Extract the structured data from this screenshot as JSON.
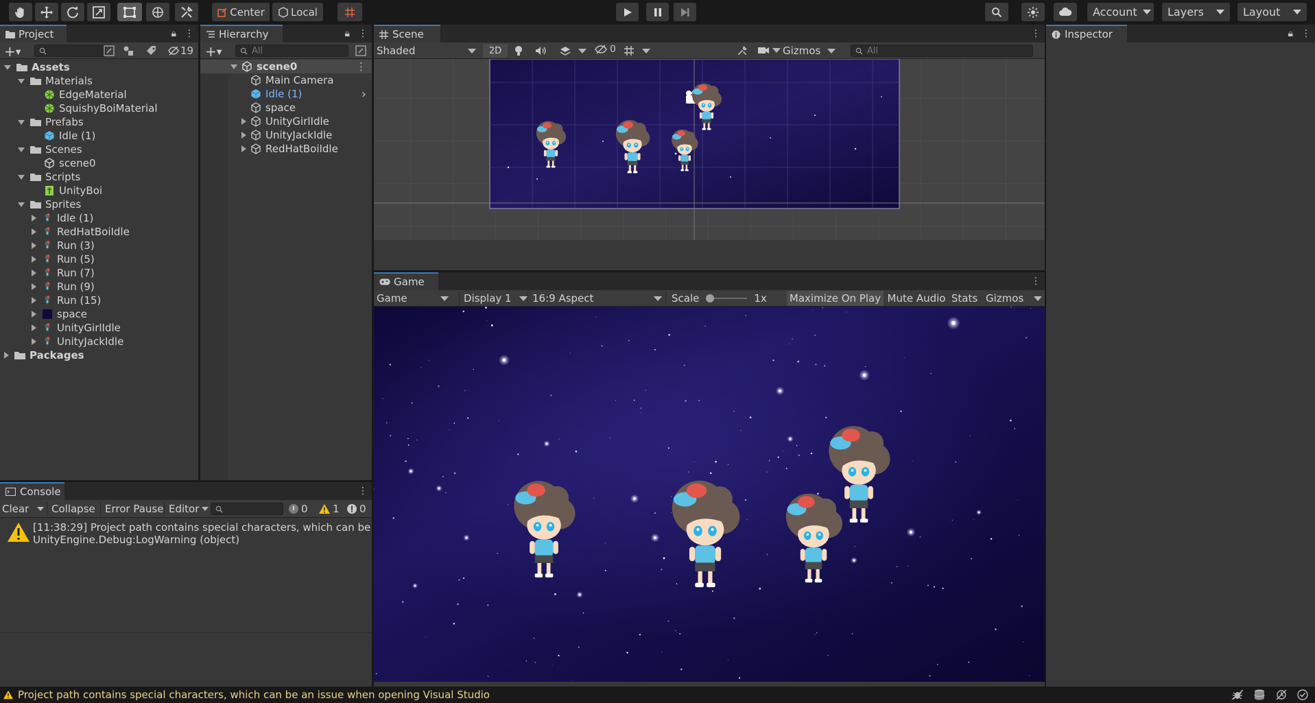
{
  "toolbar": {
    "pivot_label": "Center",
    "space_label": "Local",
    "account_label": "Account",
    "layers_label": "Layers",
    "layout_label": "Layout"
  },
  "project": {
    "tab": "Project",
    "hidden_count": "19",
    "tree": [
      {
        "label": "Assets",
        "indent": 0,
        "expand": "open",
        "icon": "folder-icon",
        "bold": true
      },
      {
        "label": "Materials",
        "indent": 1,
        "expand": "open",
        "icon": "folder-icon"
      },
      {
        "label": "EdgeMaterial",
        "indent": 2,
        "expand": "none",
        "icon": "material-icon"
      },
      {
        "label": "SquishyBoiMaterial",
        "indent": 2,
        "expand": "none",
        "icon": "material-icon"
      },
      {
        "label": "Prefabs",
        "indent": 1,
        "expand": "open",
        "icon": "folder-icon"
      },
      {
        "label": "Idle (1)",
        "indent": 2,
        "expand": "none",
        "icon": "prefab-icon"
      },
      {
        "label": "Scenes",
        "indent": 1,
        "expand": "open",
        "icon": "folder-icon"
      },
      {
        "label": "scene0",
        "indent": 2,
        "expand": "none",
        "icon": "unity-scene-icon"
      },
      {
        "label": "Scripts",
        "indent": 1,
        "expand": "open",
        "icon": "folder-icon"
      },
      {
        "label": "UnityBoi",
        "indent": 2,
        "expand": "none",
        "icon": "script-icon"
      },
      {
        "label": "Sprites",
        "indent": 1,
        "expand": "open",
        "icon": "folder-icon"
      },
      {
        "label": "Idle (1)",
        "indent": 2,
        "expand": "closed",
        "icon": "sprite-icon"
      },
      {
        "label": "RedHatBoiIdle",
        "indent": 2,
        "expand": "closed",
        "icon": "sprite-icon"
      },
      {
        "label": "Run (3)",
        "indent": 2,
        "expand": "closed",
        "icon": "sprite-icon"
      },
      {
        "label": "Run (5)",
        "indent": 2,
        "expand": "closed",
        "icon": "sprite-icon"
      },
      {
        "label": "Run (7)",
        "indent": 2,
        "expand": "closed",
        "icon": "sprite-icon"
      },
      {
        "label": "Run (9)",
        "indent": 2,
        "expand": "closed",
        "icon": "sprite-icon"
      },
      {
        "label": "Run (15)",
        "indent": 2,
        "expand": "closed",
        "icon": "sprite-icon"
      },
      {
        "label": "space",
        "indent": 2,
        "expand": "closed",
        "icon": "space-sprite-icon"
      },
      {
        "label": "UnityGirlIdle",
        "indent": 2,
        "expand": "closed",
        "icon": "sprite-icon"
      },
      {
        "label": "UnityJackIdle",
        "indent": 2,
        "expand": "closed",
        "icon": "sprite-icon"
      },
      {
        "label": "Packages",
        "indent": 0,
        "expand": "closed",
        "icon": "folder-icon",
        "bold": true
      }
    ]
  },
  "hierarchy": {
    "tab": "Hierarchy",
    "search_placeholder": "All",
    "scene_name": "scene0",
    "items": [
      {
        "label": "Main Camera",
        "expand": "none",
        "selected": false
      },
      {
        "label": "Idle (1)",
        "expand": "none",
        "selected": true
      },
      {
        "label": "space",
        "expand": "none",
        "selected": false
      },
      {
        "label": "UnityGirlIdle",
        "expand": "closed",
        "selected": false
      },
      {
        "label": "UnityJackIdle",
        "expand": "closed",
        "selected": false
      },
      {
        "label": "RedHatBoiIdle",
        "expand": "closed",
        "selected": false
      }
    ]
  },
  "scene": {
    "tab": "Scene",
    "shading_mode": "Shaded",
    "mode_2d": "2D",
    "hidden_count": "0",
    "gizmos_label": "Gizmos",
    "search_placeholder": "All"
  },
  "game": {
    "tab": "Game",
    "view_mode": "Game",
    "display": "Display 1",
    "aspect": "16:9 Aspect",
    "scale_label": "Scale",
    "scale_value": "1x",
    "scale_level": 0.0,
    "maximize_label": "Maximize On Play",
    "mute_label": "Mute Audio",
    "stats_label": "Stats",
    "gizmos_label": "Gizmos"
  },
  "inspector": {
    "tab": "Inspector"
  },
  "console": {
    "tab": "Console",
    "clear_label": "Clear",
    "collapse_label": "Collapse",
    "error_pause_label": "Error Pause",
    "editor_label": "Editor",
    "log_count": "0",
    "warning_count": "1",
    "error_count": "0",
    "entry_line1": "[11:38:29] Project path contains special characters, which can be an",
    "entry_line2": "UnityEngine.Debug:LogWarning (object)"
  },
  "status": {
    "message": "Project path contains special characters, which can be an issue when opening Visual Studio"
  },
  "colors": {
    "accent": "#3a79bb",
    "selection_text": "#7cb4ff",
    "panel_bg": "#383838",
    "toolbar_bg": "#191919",
    "warning": "#f4c20d",
    "space_bg": "#0f0a3c"
  }
}
